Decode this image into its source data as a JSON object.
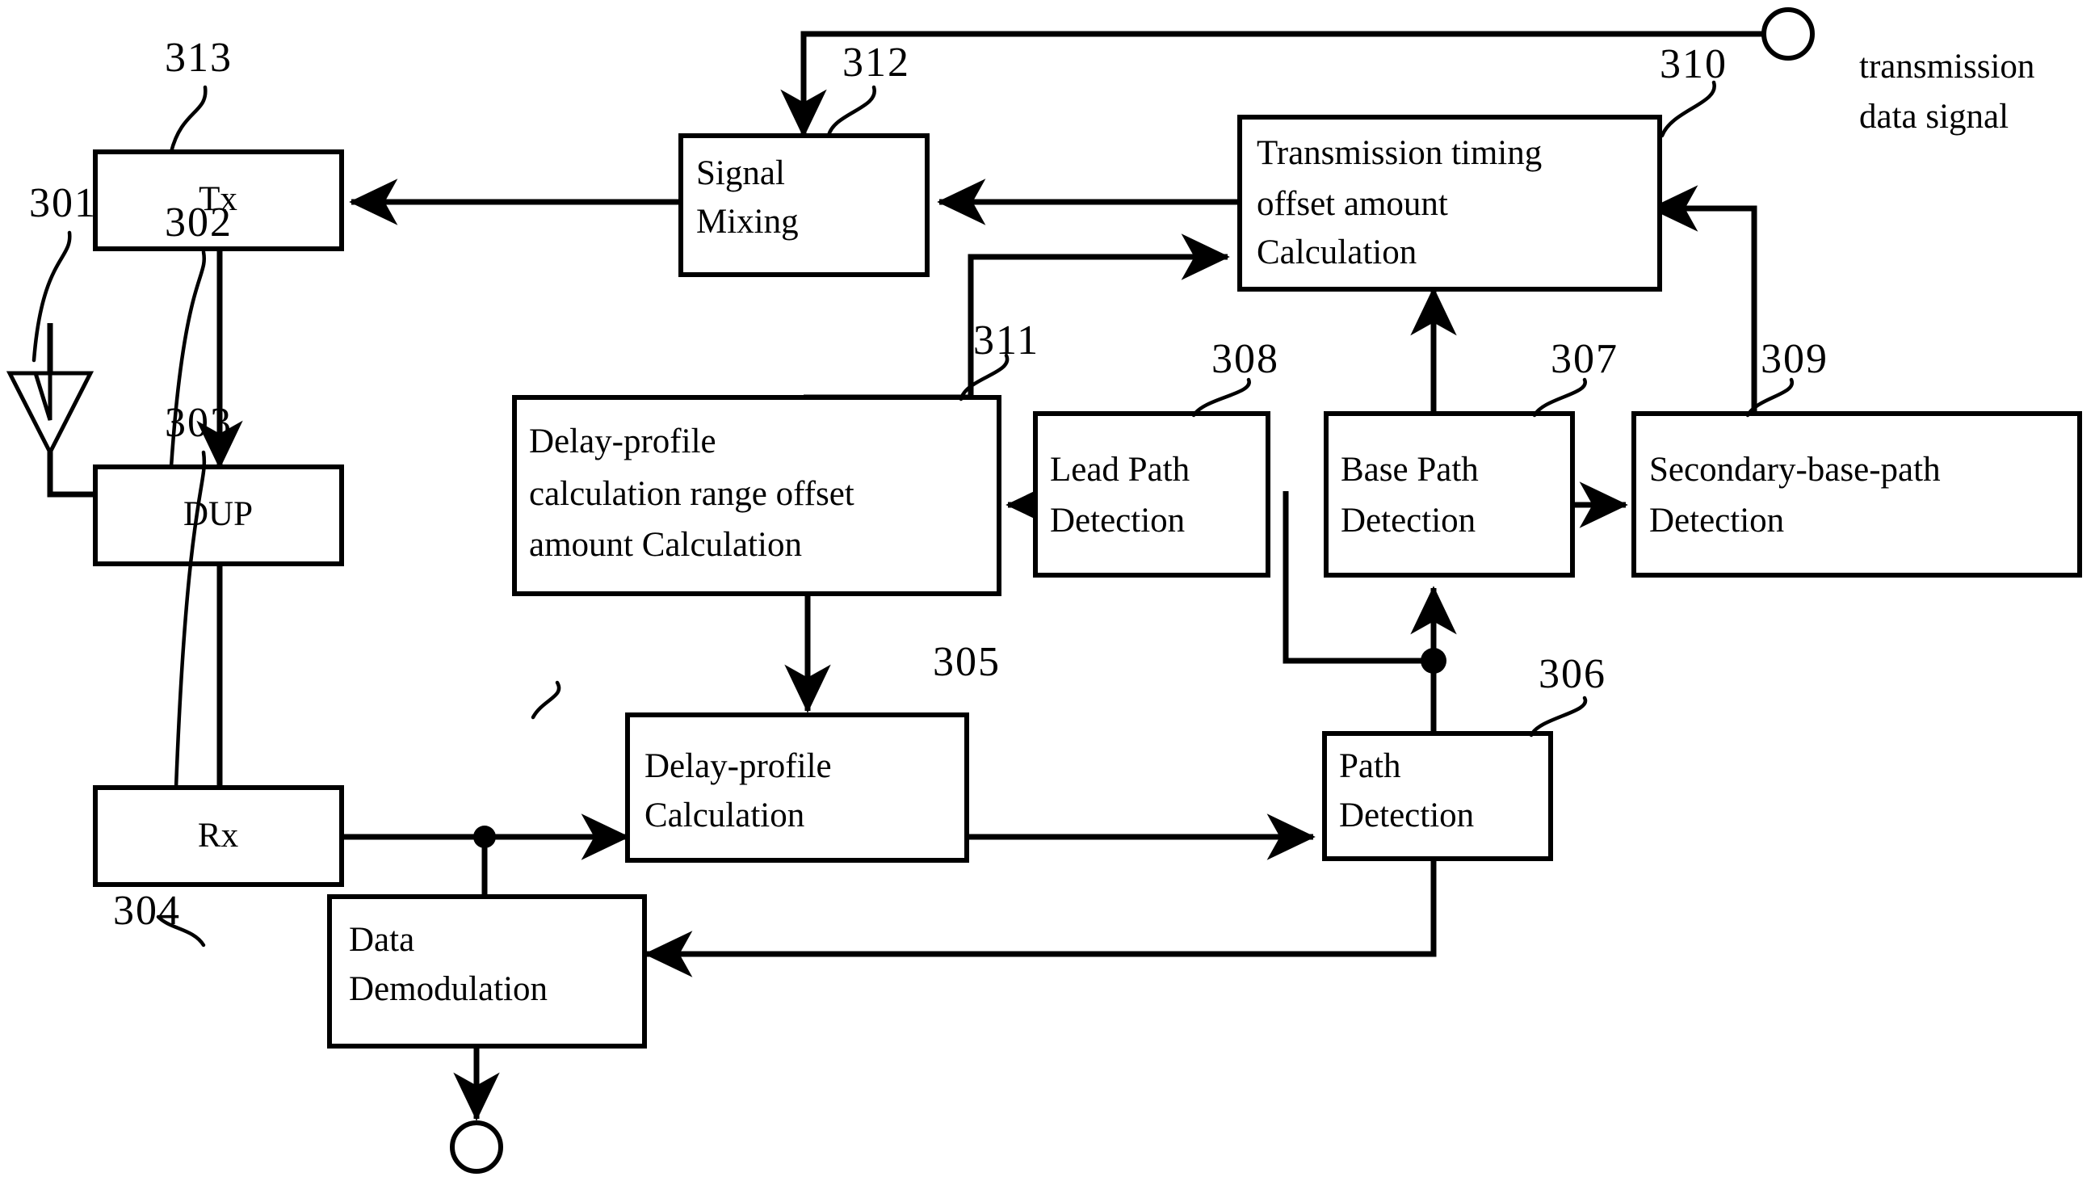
{
  "figure": {
    "kind": "patent-block-diagram",
    "background_color": "#ffffff",
    "line_color": "#000000"
  },
  "blocks": [
    {
      "id": "tx",
      "ref": "313",
      "lines": [
        "Tx"
      ]
    },
    {
      "id": "dup",
      "ref": "302",
      "lines": [
        "DUP"
      ]
    },
    {
      "id": "rx",
      "ref": "303",
      "lines": [
        "Rx"
      ]
    },
    {
      "id": "datademod",
      "ref": "304",
      "lines": [
        "Data",
        "Demodulation"
      ]
    },
    {
      "id": "sigmix",
      "ref": "312",
      "lines": [
        "Signal",
        "Mixing"
      ]
    },
    {
      "id": "dpoffset",
      "ref": "311",
      "lines": [
        "Delay-profile",
        "calculation range offset",
        "amount Calculation"
      ]
    },
    {
      "id": "dpcalc",
      "ref": "305",
      "lines": [
        "Delay-profile",
        "Calculation"
      ]
    },
    {
      "id": "pathdet",
      "ref": "306",
      "lines": [
        "Path",
        "Detection"
      ]
    },
    {
      "id": "leadpath",
      "ref": "308",
      "lines": [
        "Lead Path",
        "Detection"
      ]
    },
    {
      "id": "basepath",
      "ref": "307",
      "lines": [
        "Base Path",
        "Detection"
      ]
    },
    {
      "id": "secbase",
      "ref": "309",
      "lines": [
        "Secondary-base-path",
        "Detection"
      ]
    },
    {
      "id": "txtiming",
      "ref": "310",
      "lines": [
        "Transmission timing",
        "offset amount",
        "Calculation"
      ]
    }
  ],
  "block_labels": {
    "tx_l1": "Tx",
    "dup_l1": "DUP",
    "rx_l1": "Rx",
    "datademod_l1": "Data",
    "datademod_l2": "Demodulation",
    "sigmix_l1": "Signal",
    "sigmix_l2": "Mixing",
    "dpoffset_l1": "Delay-profile",
    "dpoffset_l2": "calculation range offset",
    "dpoffset_l3": "amount Calculation",
    "dpcalc_l1": "Delay-profile",
    "dpcalc_l2": "Calculation",
    "pathdet_l1": "Path",
    "pathdet_l2": "Detection",
    "leadpath_l1": "Lead Path",
    "leadpath_l2": "Detection",
    "basepath_l1": "Base Path",
    "basepath_l2": "Detection",
    "secbase_l1": "Secondary-base-path",
    "secbase_l2": "Detection",
    "txtiming_l1": "Transmission timing",
    "txtiming_l2": "offset amount",
    "txtiming_l3": "Calculation"
  },
  "reference_numerals": {
    "antenna": "301",
    "dup": "302",
    "rx": "303",
    "data_demodulation": "304",
    "delay_profile_calculation": "305",
    "path_detection": "306",
    "base_path_detection": "307",
    "lead_path_detection": "308",
    "secondary_base_path_detection": "309",
    "transmission_timing_offset": "310",
    "delay_profile_range_offset": "311",
    "signal_mixing": "312",
    "tx": "313"
  },
  "external_labels": {
    "transmission_data_signal_line1": "transmission",
    "transmission_data_signal_line2": "data signal"
  },
  "terminals": [
    {
      "id": "top-right-terminal",
      "shape": "open-circle"
    },
    {
      "id": "bottom-output-terminal",
      "shape": "open-circle"
    }
  ],
  "icons": {
    "antenna": "antenna-icon",
    "arrowhead": "arrow-icon",
    "junction": "junction-dot-icon"
  }
}
